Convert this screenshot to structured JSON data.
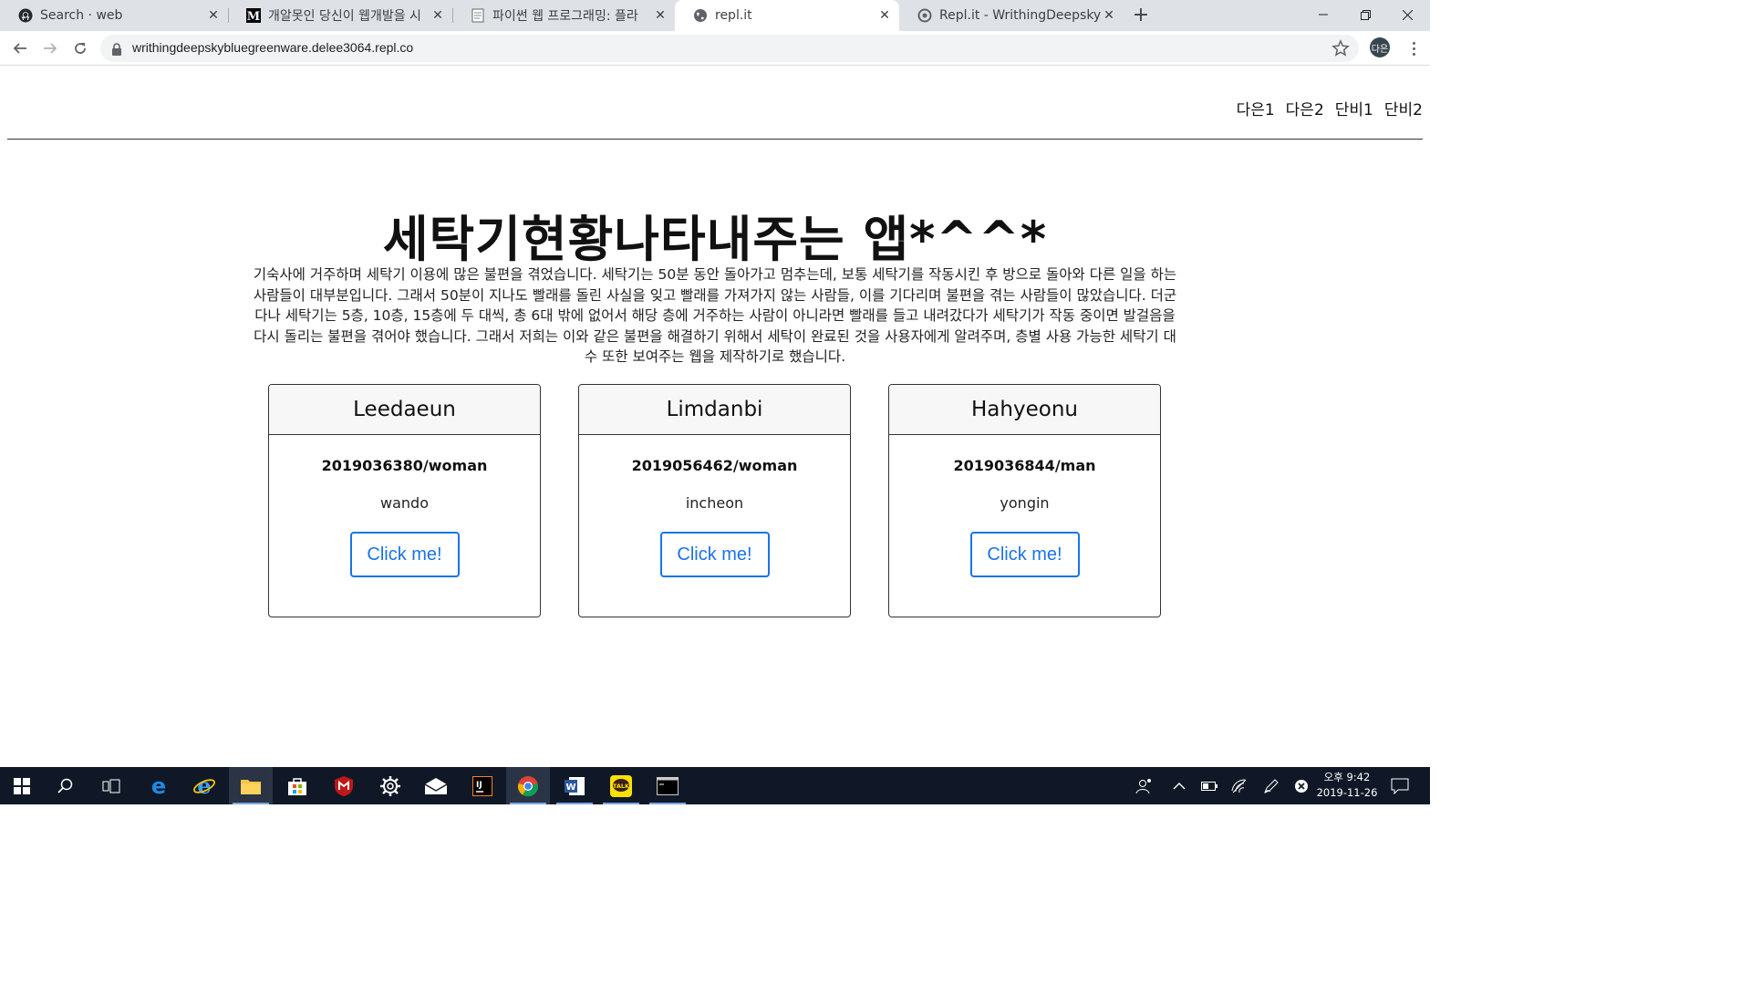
{
  "browser": {
    "tabs": [
      {
        "title": "Search · web",
        "icon": "github-icon"
      },
      {
        "title": "개알못인 당신이 웹개발을 시",
        "icon": "medium-icon"
      },
      {
        "title": "파이썬 웹 프로그래밍: 플라",
        "icon": "document-icon"
      },
      {
        "title": "repl.it",
        "icon": "globe-icon"
      },
      {
        "title": "Repl.it - WrithingDeepskyb",
        "icon": "replit-icon"
      }
    ],
    "active_tab": 3,
    "url": "writhingdeepskybluegreenware.delee3064.repl.co",
    "profile_initial": "다은"
  },
  "page": {
    "nav": [
      "다은1",
      "다은2",
      "단비1",
      "단비2"
    ],
    "title": "세탁기현황나타내주는 앱*^^*",
    "description": "기숙사에 거주하며 세탁기 이용에 많은 불편을 겪었습니다. 세탁기는 50분 동안 돌아가고 멈추는데, 보통 세탁기를 작동시킨 후 방으로 돌아와 다른 일을 하는 사람들이 대부분입니다. 그래서 50분이 지나도 빨래를 돌린 사실을 잊고 빨래를 가져가지 않는 사람들, 이를 기다리며 불편을 겪는 사람들이 많았습니다. 더군다나 세탁기는 5층, 10층, 15층에 두 대씩, 총 6대 밖에 없어서 해당 층에 거주하는 사람이 아니라면 빨래를 들고 내려갔다가 세탁기가 작동 중이면 발걸음을 다시 돌리는 불편을 겪어야 했습니다. 그래서 저희는 이와 같은 불편을 해결하기 위해서 세탁이 완료된 것을 사용자에게 알려주며, 층별 사용 가능한 세탁기 대 수 또한 보여주는 웹을 제작하기로 했습니다.",
    "cards": [
      {
        "name": "Leedaeun",
        "id": "2019036380/woman",
        "city": "wando",
        "button": "Click me!"
      },
      {
        "name": "Limdanbi",
        "id": "2019056462/woman",
        "city": "incheon",
        "button": "Click me!"
      },
      {
        "name": "Hahyeonu",
        "id": "2019036844/man",
        "city": "yongin",
        "button": "Click me!"
      }
    ]
  },
  "taskbar": {
    "apps": [
      "start-icon",
      "search-icon",
      "task-view-icon",
      "edge-icon",
      "ie-icon",
      "file-explorer-icon",
      "store-icon",
      "mcafee-icon",
      "settings-icon",
      "mail-icon",
      "intellij-icon",
      "chrome-icon",
      "word-icon",
      "kakaotalk-icon",
      "terminal-icon"
    ],
    "clock_time": "오후 9:42",
    "clock_date": "2019-11-26",
    "kakao_label": "TALK"
  }
}
